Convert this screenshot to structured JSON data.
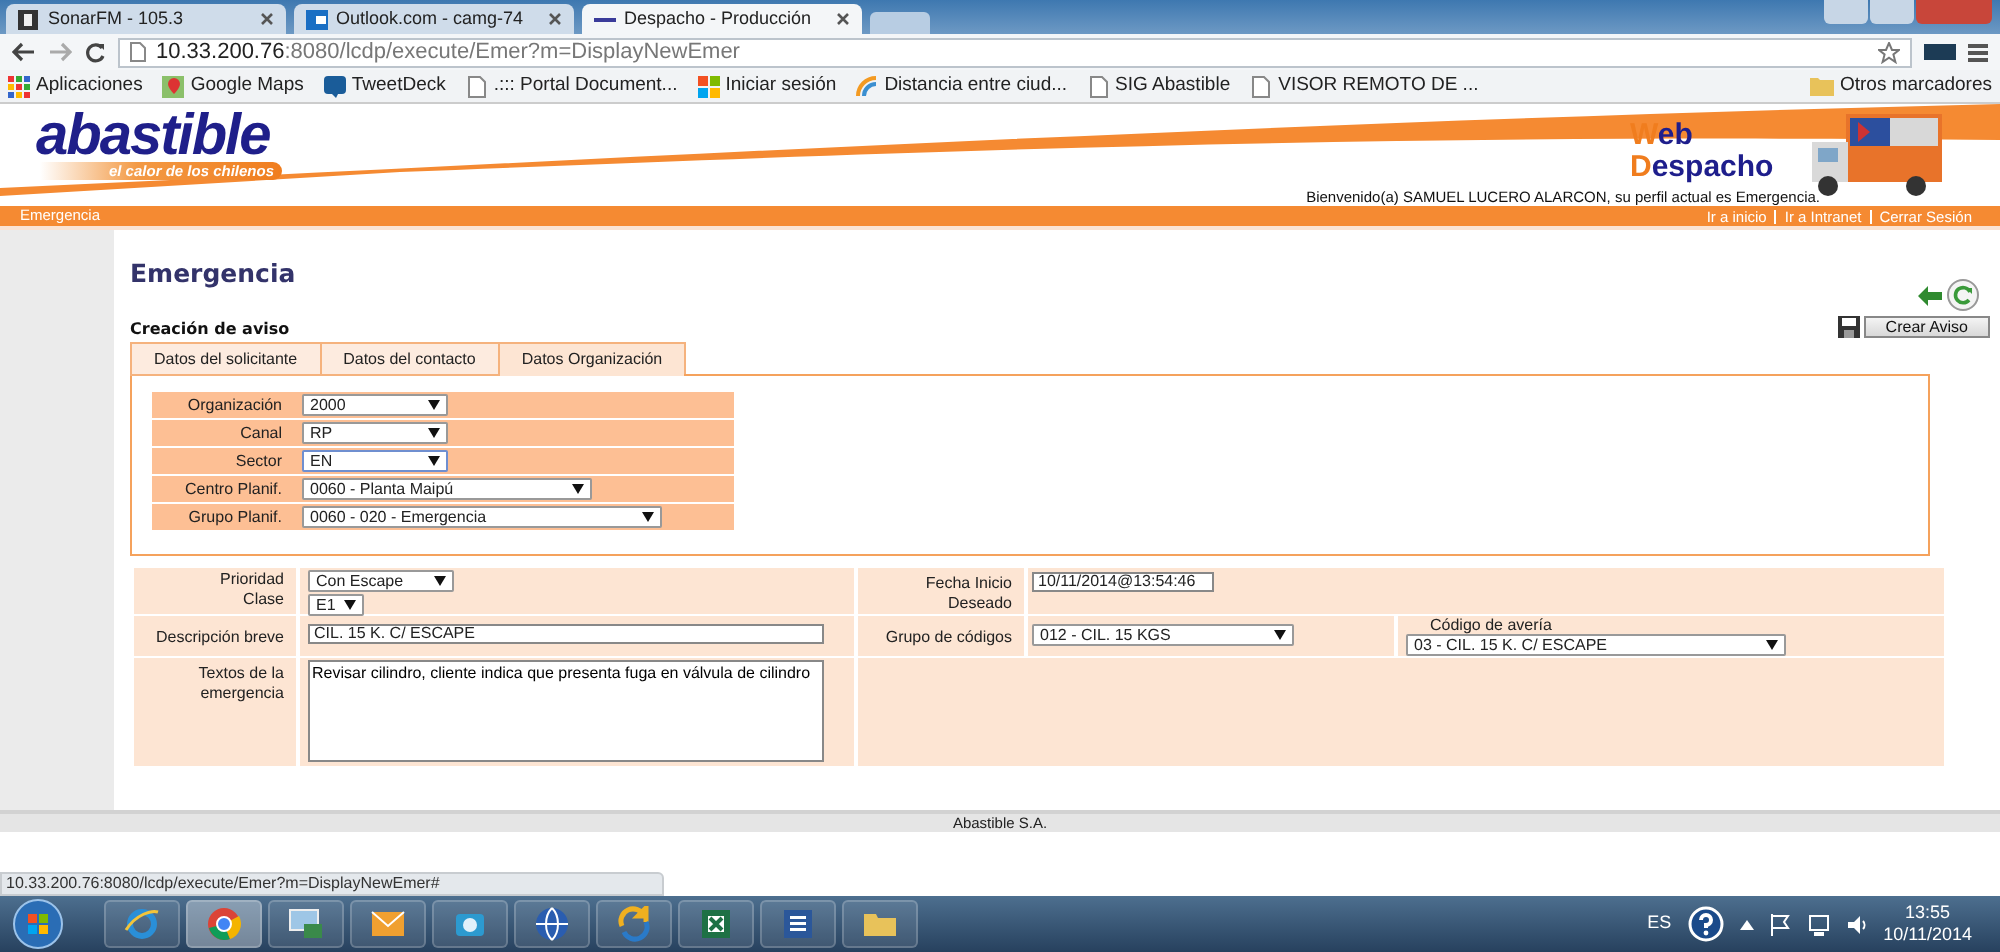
{
  "browser": {
    "tabs": [
      {
        "title": "SonarFM - 105.3",
        "kind": "sonar",
        "selected": false
      },
      {
        "title": "Outlook.com - camg-74",
        "kind": "outlook",
        "selected": false
      },
      {
        "title": "Despacho - Producción",
        "kind": "page",
        "selected": true
      }
    ],
    "url": {
      "host": "10.33.200.76",
      "path": ":8080/lcdp/execute/Emer?m=DisplayNewEmer"
    },
    "bookmarks": [
      {
        "label": "Aplicaciones",
        "kind": "apps"
      },
      {
        "label": "Google Maps",
        "kind": "maps"
      },
      {
        "label": "TweetDeck",
        "kind": "bird"
      },
      {
        "label": ".::: Portal Document...",
        "kind": "page"
      },
      {
        "label": "Iniciar sesión",
        "kind": "windows"
      },
      {
        "label": "Distancia entre ciud...",
        "kind": "arc"
      },
      {
        "label": "SIG Abastible",
        "kind": "page"
      },
      {
        "label": "VISOR REMOTO DE ...",
        "kind": "page"
      }
    ],
    "other_bookmarks": "Otros marcadores"
  },
  "header": {
    "brand": "abastible",
    "slogan": "el calor de los chilenos",
    "app_name": [
      "Web",
      "Despacho"
    ],
    "welcome": "Bienvenido(a) SAMUEL LUCERO ALARCON, su perfil actual es Emergencia.",
    "section": "Emergencia",
    "links": [
      "Ir a inicio",
      "Ir a Intranet",
      "Cerrar Sesión"
    ]
  },
  "page": {
    "title": "Emergencia",
    "subtitle": "Creación de aviso",
    "create_button": "Crear Aviso",
    "tabs": [
      {
        "label": "Datos del solicitante",
        "selected": false
      },
      {
        "label": "Datos del contacto",
        "selected": false
      },
      {
        "label": "Datos Organización",
        "selected": true
      }
    ],
    "organization_fields": [
      {
        "label": "Organización",
        "value": "2000",
        "focused": false
      },
      {
        "label": "Canal",
        "value": "RP",
        "focused": false
      },
      {
        "label": "Sector",
        "value": "EN",
        "focused": true
      },
      {
        "label": "Centro Planif.",
        "value": "0060 - Planta Maipú",
        "focused": false
      },
      {
        "label": "Grupo Planif.",
        "value": "0060 - 020 - Emergencia",
        "focused": false
      }
    ],
    "form": {
      "priority": {
        "label": "Prioridad",
        "value": "Con Escape"
      },
      "class": {
        "label": "Clase",
        "value": "E1"
      },
      "short_description": {
        "label": "Descripción breve",
        "value": "CIL. 15 K. C/ ESCAPE"
      },
      "text": {
        "label": "Textos de la emergencia",
        "value": "Revisar cilindro, cliente indica que presenta fuga en válvula de cilindro"
      },
      "desired_start": {
        "label": "Fecha Inicio Deseado",
        "value": "10/11/2014@13:54:46"
      },
      "code_group": {
        "label": "Grupo de códigos",
        "value": "012 - CIL. 15 KGS"
      },
      "failure_code": {
        "label": "Código de avería",
        "value": "03 - CIL. 15 K. C/ ESCAPE"
      }
    }
  },
  "footer": "Abastible S.A.",
  "status_url": "10.33.200.76:8080/lcdp/execute/Emer?m=DisplayNewEmer#",
  "taskbar": {
    "apps": [
      {
        "kind": "ie",
        "selected": false
      },
      {
        "kind": "chrome",
        "selected": true
      },
      {
        "kind": "remote",
        "selected": false
      },
      {
        "kind": "outlook",
        "selected": false
      },
      {
        "kind": "camera",
        "selected": false
      },
      {
        "kind": "earth",
        "selected": false
      },
      {
        "kind": "arrows",
        "selected": false
      },
      {
        "kind": "excel",
        "selected": false
      },
      {
        "kind": "word",
        "selected": false
      },
      {
        "kind": "explorer",
        "selected": false
      }
    ],
    "language": "ES",
    "time": "13:55",
    "date": "10/11/2014"
  }
}
